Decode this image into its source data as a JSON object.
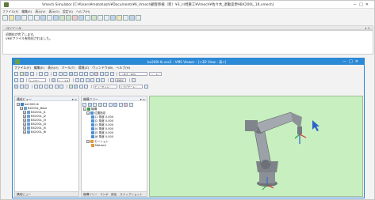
{
  "sim": {
    "title": "Vmech Simulator [C:¥Users¥motohashi¥Documents¥6_Vmech顧客移植（新）¥3_川崎重工¥Vmech¥佐々木_退勤変更¥BX200L_1K.vmech]",
    "menu": [
      "ファイル(F)",
      "編集(E)",
      "表示(V)",
      "表示(O)",
      "設定(S)",
      "ヘルプ(H)"
    ],
    "window_buttons": [
      "－",
      "□",
      "✕"
    ]
  },
  "console": {
    "header": "コンソール",
    "pin": "▾ ×",
    "lines": [
      "初期化が完了します。",
      "VMEファイル有効化されました。"
    ]
  },
  "vms": {
    "title": "bx200l-lk.vxc2 - VMS Viewer - [<3D View - 表>]",
    "menu": [
      "ファイル(F)",
      "編集(E)",
      "表示(V)",
      "ツール(T)",
      "環境(Z)",
      "ウィンドウ(W)",
      "ヘルプ(H)"
    ],
    "window_buttons": [
      "－",
      "□",
      "✕"
    ],
    "combos": {
      "zoom": "▢ 拡大・80%",
      "layer": "レイヤー",
      "frame": "▢ ・0 ・",
      "mode": "▢ ・ 1 0 ・",
      "coord": "座標系",
      "view": "ビューセット・",
      "mode2": "□ ナビゲート・"
    }
  },
  "left_panel": {
    "header": "構成ビュー",
    "pin": "▾ ×",
    "items": [
      {
        "label": "bx2000-lk",
        "level": 0,
        "expand": "−"
      },
      {
        "label": "BX200L_Base",
        "level": 1,
        "expand": "−"
      },
      {
        "label": "BX200L_J1",
        "level": 2,
        "expand": "+"
      },
      {
        "label": "BX200L_J2",
        "level": 2,
        "expand": "+"
      },
      {
        "label": "BX200L_J3",
        "level": 2,
        "expand": "+"
      },
      {
        "label": "BX200L_J4",
        "level": 2,
        "expand": "+"
      },
      {
        "label": "BX200L_J5",
        "level": 2,
        "expand": "+"
      },
      {
        "label": "BX200L_J6",
        "level": 2,
        "expand": "+"
      }
    ],
    "bottom_tab": "構成ビュー"
  },
  "mid_panel": {
    "header": "機構ツリー",
    "pin": "▾ ×",
    "items": [
      {
        "label": "機構",
        "level": 0,
        "expand": "−"
      },
      {
        "label": "位置指定",
        "level": 1,
        "expand": "−"
      },
      {
        "label": "J1 角度 0.000",
        "level": 2
      },
      {
        "label": "J2 角度 0.000",
        "level": 2
      },
      {
        "label": "J3 角度 0.000",
        "level": 2
      },
      {
        "label": "J4 角度 0.000",
        "level": 2
      },
      {
        "label": "J5 角度 0.000",
        "level": 2
      },
      {
        "label": "J6 角度 0.000",
        "level": 2
      },
      {
        "label": "モーション",
        "level": 1,
        "expand": "−"
      },
      {
        "label": "Motion1",
        "level": 2
      }
    ],
    "bottom_tabs": [
      "機構ツリー",
      "コンポ",
      "部品",
      "スナップショット"
    ]
  },
  "colors": {
    "vms_titlebar": "#2b8ad6",
    "viewport_bg": "#c7efbf",
    "robot": "#8a8f95",
    "axis_x": "#e03030",
    "axis_y": "#30a040",
    "axis_z": "#2f5fd0",
    "cursor": "#2c63c9"
  }
}
